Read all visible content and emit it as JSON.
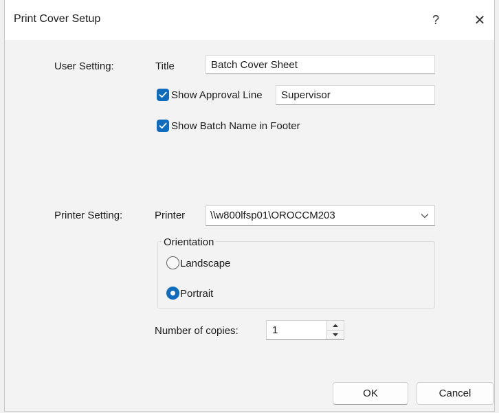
{
  "dialog": {
    "title": "Print Cover Setup",
    "help_label": "?",
    "close_label": "✕"
  },
  "user_setting": {
    "label": "User Setting:",
    "title_label": "Title",
    "title_value": "Batch Cover Sheet",
    "approval_line": {
      "label": "Show Approval Line",
      "checked": true,
      "value": "Supervisor"
    },
    "batch_name_footer": {
      "label": "Show Batch Name in Footer",
      "checked": true
    }
  },
  "printer_setting": {
    "label": "Printer Setting:",
    "printer_label": "Printer",
    "printer_value": "\\\\w800lfsp01\\OROCCM203",
    "orientation": {
      "legend": "Orientation",
      "options": [
        {
          "label": "Landscape",
          "selected": false
        },
        {
          "label": "Portrait",
          "selected": true
        }
      ]
    },
    "copies_label": "Number of copies:",
    "copies_value": "1"
  },
  "buttons": {
    "ok": "OK",
    "cancel": "Cancel"
  },
  "colors": {
    "accent": "#0f6cbd",
    "window_bg": "#f3f3f3",
    "titlebar_bg": "#ffffff"
  },
  "icons": [
    "help-icon",
    "close-icon",
    "checkmark-icon",
    "chevron-down-icon",
    "spin-up-icon",
    "spin-down-icon"
  ]
}
